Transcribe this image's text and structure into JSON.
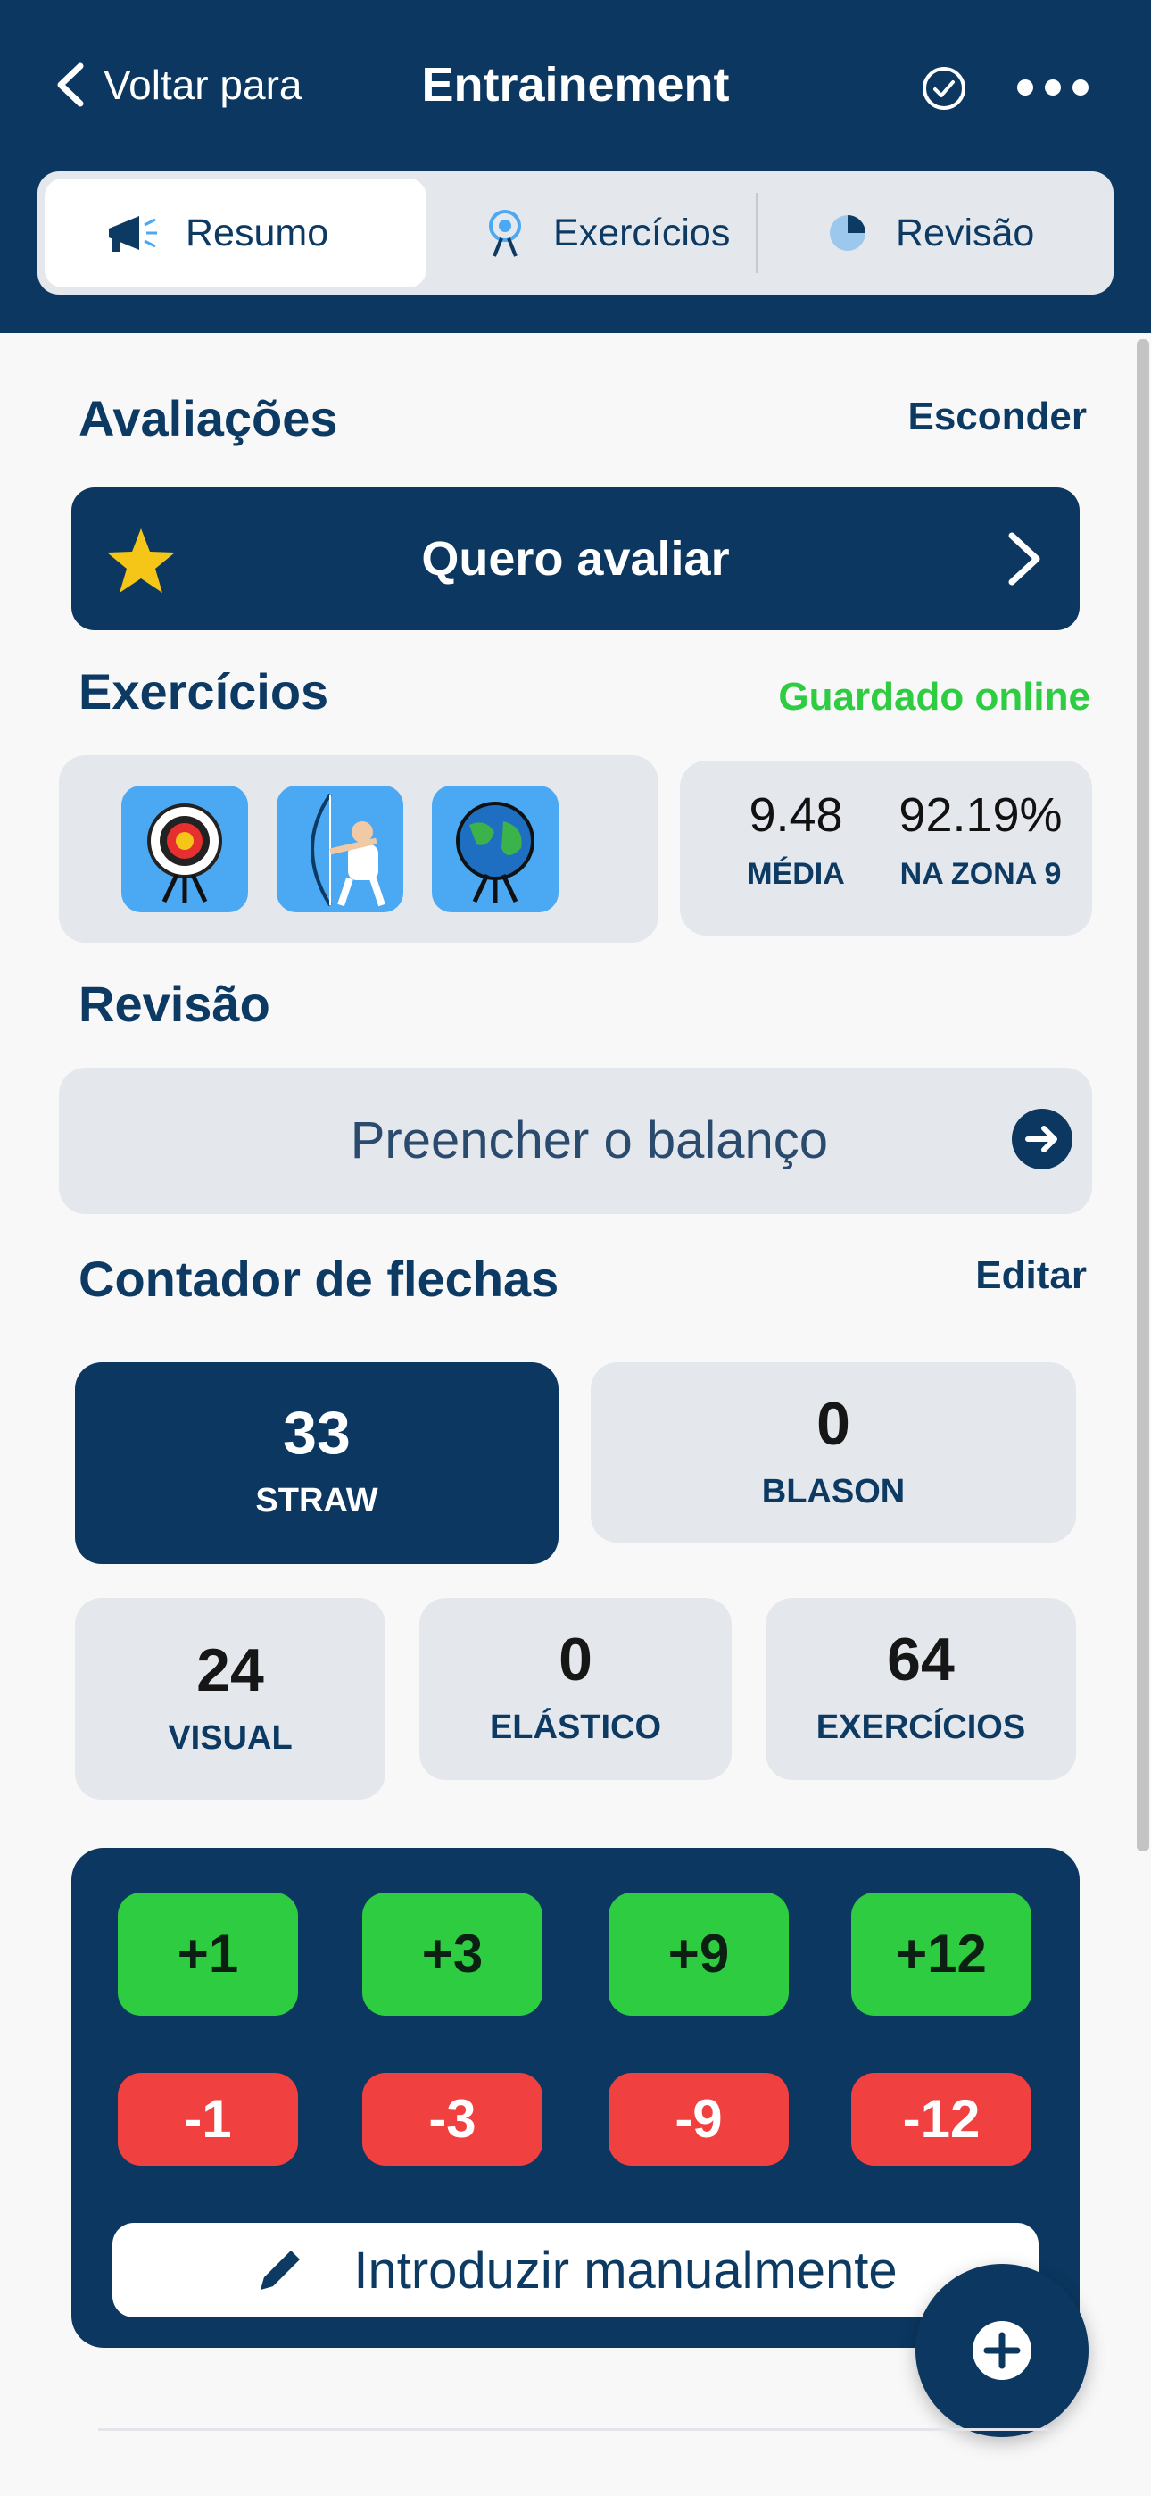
{
  "header": {
    "back_label": "Voltar para",
    "title": "Entrainement",
    "tabs": [
      {
        "label": "Resumo",
        "active": true
      },
      {
        "label": "Exercícios",
        "active": false
      },
      {
        "label": "Revisão",
        "active": false
      }
    ]
  },
  "ratings": {
    "title": "Avaliações",
    "hide_label": "Esconder",
    "button_label": "Quero avaliar"
  },
  "exercises": {
    "title": "Exercícios",
    "status": "Guardado online",
    "icons": [
      "target-icon",
      "archer-icon",
      "earth-target-icon"
    ],
    "stats": [
      {
        "value": "9.48",
        "label": "MÉDIA"
      },
      {
        "value": "92.19%",
        "label": "NA ZONA 9"
      }
    ]
  },
  "review": {
    "title": "Revisão",
    "button_label": "Preencher o balanço"
  },
  "arrow_counter": {
    "title": "Contador de flechas",
    "edit_label": "Editar",
    "counters": [
      {
        "value": "33",
        "label": "STRAW"
      },
      {
        "value": "0",
        "label": "BLASON"
      },
      {
        "value": "24",
        "label": "VISUAL"
      },
      {
        "value": "0",
        "label": "ELÁSTICO"
      },
      {
        "value": "64",
        "label": "EXERCÍCIOS"
      }
    ],
    "plus_buttons": [
      "+1",
      "+3",
      "+9",
      "+12"
    ],
    "minus_buttons": [
      "-1",
      "-3",
      "-9",
      "-12"
    ],
    "manual_label": "Introduzir manualmente"
  },
  "colors": {
    "navy": "#0b3760",
    "green": "#2ecc40",
    "red": "#f04040",
    "star": "#f5c518"
  }
}
